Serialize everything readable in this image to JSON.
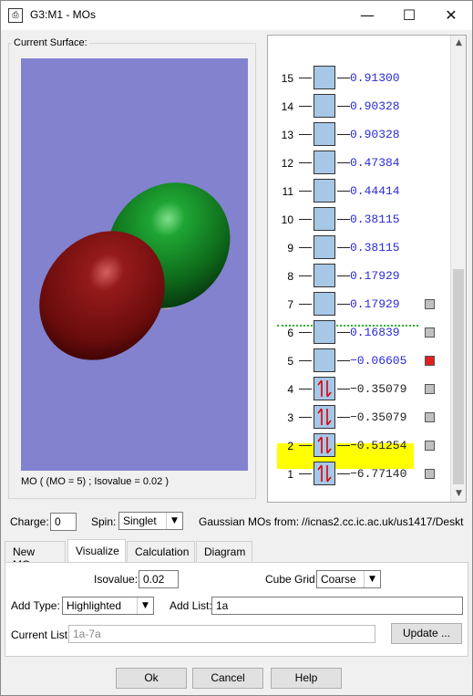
{
  "window": {
    "title": "G3:M1 - MOs",
    "icon": "app-doc-icon",
    "controls": {
      "minimize": "—",
      "maximize": "☐",
      "close": "✕"
    }
  },
  "surface": {
    "group_label": "Current Surface:",
    "caption": "MO ( (MO = 5) ; Isovalue = 0.02 )",
    "colors": {
      "background": "#8282cf",
      "positive": "#1a8a2a",
      "negative": "#8a1212"
    }
  },
  "levels": [
    {
      "num": "15",
      "energy": "0.91300",
      "occupied": false,
      "marker": ""
    },
    {
      "num": "14",
      "energy": "0.90328",
      "occupied": false,
      "marker": ""
    },
    {
      "num": "13",
      "energy": "0.90328",
      "occupied": false,
      "marker": ""
    },
    {
      "num": "12",
      "energy": "0.47384",
      "occupied": false,
      "marker": ""
    },
    {
      "num": "11",
      "energy": "0.44414",
      "occupied": false,
      "marker": ""
    },
    {
      "num": "10",
      "energy": "0.38115",
      "occupied": false,
      "marker": ""
    },
    {
      "num": "9",
      "energy": "0.38115",
      "occupied": false,
      "marker": ""
    },
    {
      "num": "8",
      "energy": "0.17929",
      "occupied": false,
      "marker": ""
    },
    {
      "num": "7",
      "energy": "0.17929",
      "occupied": false,
      "marker": "gray"
    },
    {
      "num": "6",
      "energy": "0.16839",
      "occupied": false,
      "marker": "gray"
    },
    {
      "num": "5",
      "energy": "−0.06605",
      "occupied": false,
      "marker": "red"
    },
    {
      "num": "4",
      "energy": "−0.35079",
      "occupied": true,
      "marker": "gray"
    },
    {
      "num": "3",
      "energy": "−0.35079",
      "occupied": true,
      "marker": "gray"
    },
    {
      "num": "2",
      "energy": "−0.51254",
      "occupied": true,
      "marker": "gray"
    },
    {
      "num": "1",
      "energy": "−6.77140",
      "occupied": true,
      "marker": "gray"
    }
  ],
  "controls": {
    "charge_label": "Charge:",
    "charge_value": "0",
    "spin_label": "Spin:",
    "spin_value": "Singlet",
    "source_label": "Gaussian MOs from:",
    "source_value": "//icnas2.cc.ic.ac.uk/us1417/Deskt"
  },
  "tabs": [
    {
      "label": "New MOs",
      "active": false
    },
    {
      "label": "Visualize",
      "active": true
    },
    {
      "label": "Calculation",
      "active": false
    },
    {
      "label": "Diagram",
      "active": false
    }
  ],
  "visualize": {
    "isovalue_label": "Isovalue:",
    "isovalue": "0.02",
    "cubegrid_label": "Cube Grid:",
    "cubegrid": "Coarse",
    "addtype_label": "Add Type:",
    "addtype": "Highlighted",
    "addlist_label": "Add List:",
    "addlist": "1a",
    "currentlist_label": "Current List:",
    "currentlist": "1a-7a",
    "update_label": "Update ..."
  },
  "footer": {
    "ok": "Ok",
    "cancel": "Cancel",
    "help": "Help"
  }
}
